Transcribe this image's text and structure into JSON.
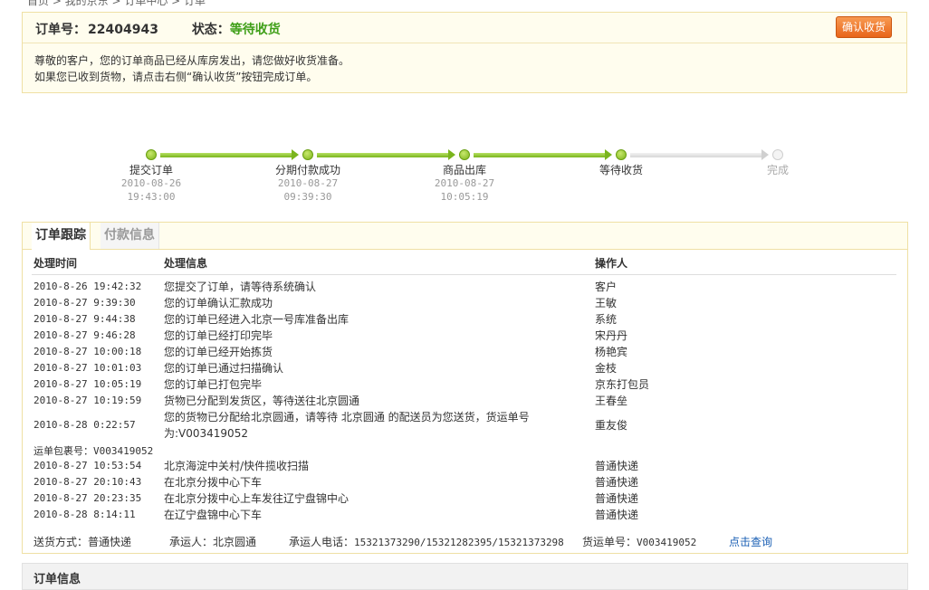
{
  "breadcrumb": "首页 > 我的京东 > 订单中心 > 订单",
  "order": {
    "id_label": "订单号：",
    "id_value": "22404943",
    "state_label": "状态：",
    "state_value": "等待收货",
    "confirm_button": "确认收货",
    "message_line1": "尊敬的客户，您的订单商品已经从库房发出，请您做好收货准备。",
    "message_line2": "如果您已收到货物，请点击右侧“确认收货”按钮完成订单。"
  },
  "progress": {
    "steps": [
      {
        "label": "提交订单",
        "date": "2010-08-26",
        "time": "19:43:00",
        "status": "done"
      },
      {
        "label": "分期付款成功",
        "date": "2010-08-27",
        "time": "09:39:30",
        "status": "done"
      },
      {
        "label": "商品出库",
        "date": "2010-08-27",
        "time": "10:05:19",
        "status": "done"
      },
      {
        "label": "等待收货",
        "date": "",
        "time": "",
        "status": "done"
      },
      {
        "label": "完成",
        "date": "",
        "time": "",
        "status": "todo"
      }
    ]
  },
  "tracking": {
    "tabs": [
      "订单跟踪",
      "付款信息"
    ],
    "headers": {
      "time": "处理时间",
      "info": "处理信息",
      "operator": "操作人"
    },
    "rows": [
      {
        "time": "2010-8-26 19:42:32",
        "info": "您提交了订单，请等待系统确认",
        "operator": "客户"
      },
      {
        "time": "2010-8-27 9:39:30",
        "info": "您的订单确认汇款成功",
        "operator": "王敏"
      },
      {
        "time": "2010-8-27 9:44:38",
        "info": "您的订单已经进入北京一号库准备出库",
        "operator": "系统"
      },
      {
        "time": "2010-8-27 9:46:28",
        "info": "您的订单已经打印完毕",
        "operator": "宋丹丹"
      },
      {
        "time": "2010-8-27 10:00:18",
        "info": "您的订单已经开始拣货",
        "operator": "杨艳宾"
      },
      {
        "time": "2010-8-27 10:01:03",
        "info": "您的订单已通过扫描确认",
        "operator": "金枝"
      },
      {
        "time": "2010-8-27 10:05:19",
        "info": "您的订单已打包完毕",
        "operator": "京东打包员"
      },
      {
        "time": "2010-8-27 10:19:59",
        "info": "货物已分配到发货区，等待送往北京圆通",
        "operator": "王春垒"
      },
      {
        "time": "2010-8-28 0:22:57",
        "info": "您的货物已分配给北京圆通，请等待 北京圆通 的配送员为您送货，货运单号为:V003419052",
        "operator": "重友俊"
      }
    ],
    "waybill_label": "运单包裹号：",
    "waybill_value": "V003419052",
    "courier_rows": [
      {
        "time": "2010-8-27 10:53:54",
        "info": "北京海淀中关村/快件揽收扫描",
        "operator": "普通快递"
      },
      {
        "time": "2010-8-27 20:10:43",
        "info": "在北京分拨中心下车",
        "operator": "普通快递"
      },
      {
        "time": "2010-8-27 20:23:35",
        "info": "在北京分拨中心上车发往辽宁盘锦中心",
        "operator": "普通快递"
      },
      {
        "time": "2010-8-28 8:14:11",
        "info": "在辽宁盘锦中心下车",
        "operator": "普通快递"
      }
    ],
    "shipping": {
      "method_label": "送货方式：",
      "method_value": "普通快递",
      "carrier_label": "承运人：",
      "carrier_value": "北京圆通",
      "phone_label": "承运人电话：",
      "phone_value": "15321373290/15321282395/15321373298",
      "waybill_label": "货运单号：",
      "waybill_value": "V003419052",
      "query_link": "点击查询"
    }
  },
  "order_info_title": "订单信息",
  "colors": {
    "accent_green": "#3f9f18",
    "button_orange": "#e8651a",
    "border_yellow": "#efe0a4",
    "link_blue": "#1a5fb4"
  }
}
